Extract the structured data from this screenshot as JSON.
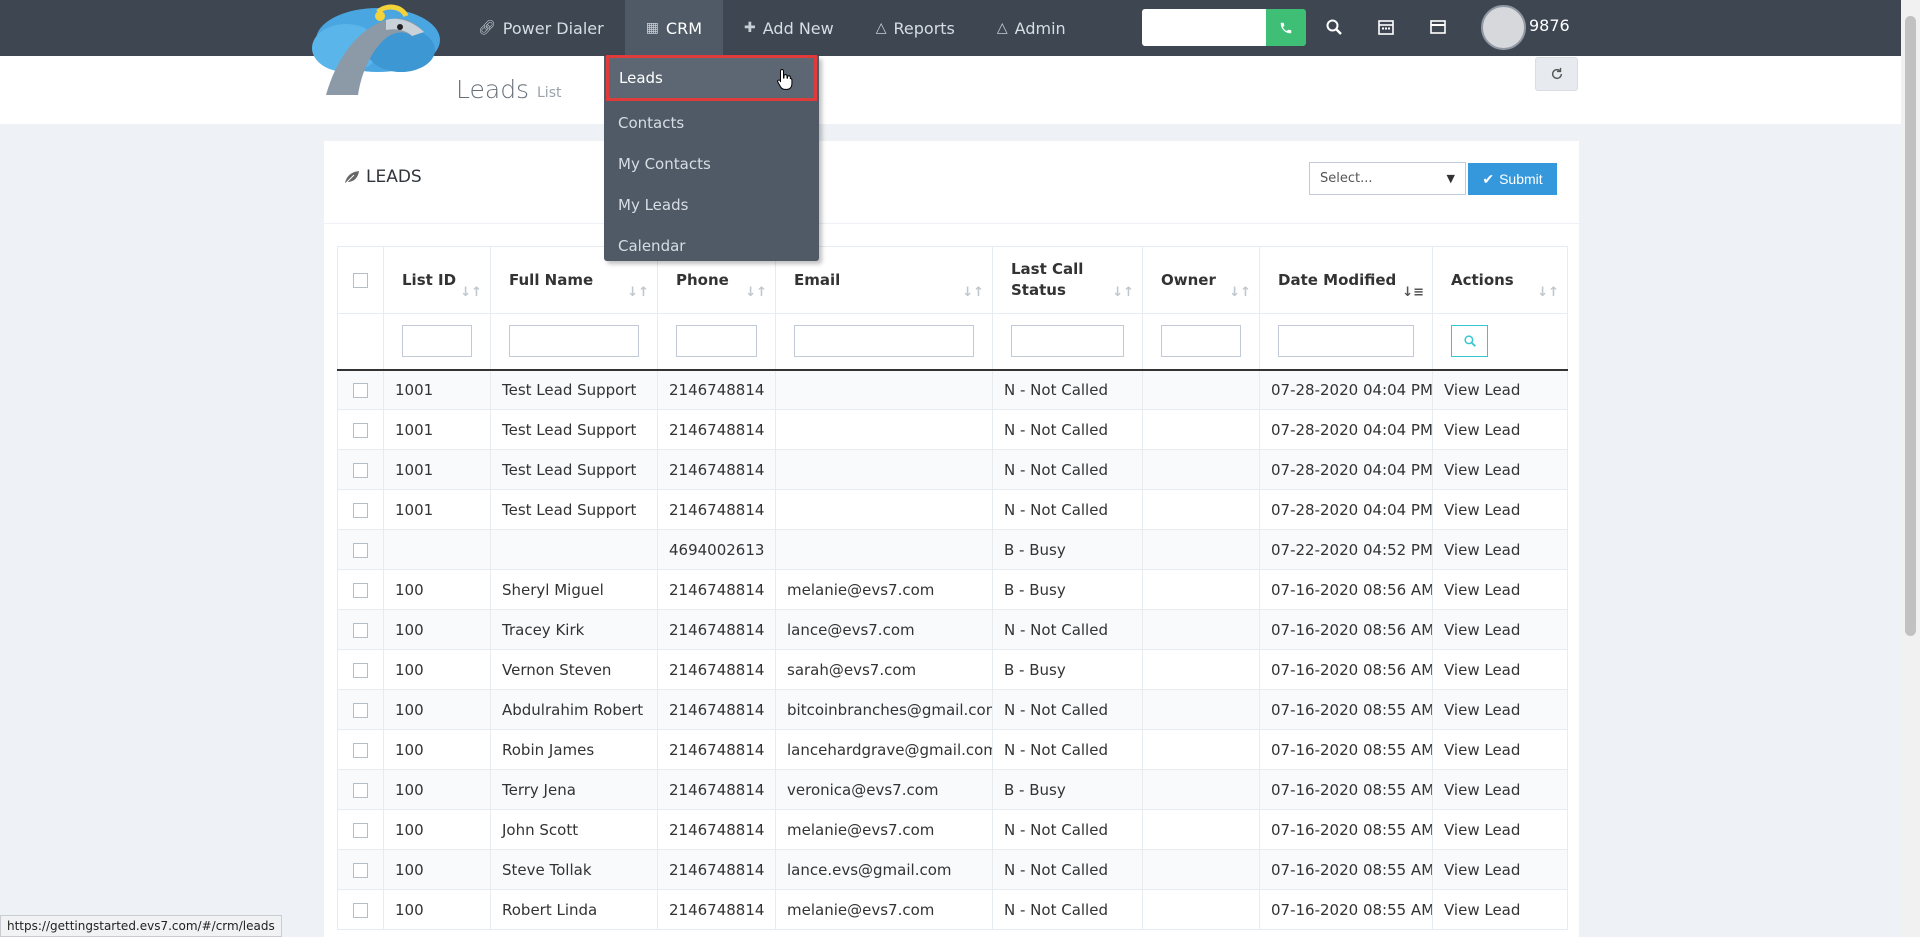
{
  "nav": {
    "items": [
      {
        "label": "Power Dialer",
        "icon": "link-icon"
      },
      {
        "label": "CRM",
        "icon": "book-icon"
      },
      {
        "label": "Add New",
        "icon": "plus-icon"
      },
      {
        "label": "Reports",
        "icon": "flask-icon"
      },
      {
        "label": "Admin",
        "icon": "flask-icon"
      }
    ],
    "user_id": "9876"
  },
  "page": {
    "title": "Leads",
    "subtitle": "List"
  },
  "crm_menu": {
    "items": [
      "Leads",
      "Contacts",
      "My Contacts",
      "My Leads",
      "Calendar"
    ]
  },
  "portlet": {
    "title": "LEADS",
    "select_placeholder": "Select...",
    "submit_label": "Submit"
  },
  "table": {
    "columns": [
      "List ID",
      "Full Name",
      "Phone",
      "Email",
      "Last Call Status",
      "Owner",
      "Date Modified",
      "Actions"
    ],
    "rows": [
      {
        "list_id": "1001",
        "name": "Test Lead Support",
        "phone": "2146748814",
        "email": "",
        "status": "N - Not Called",
        "owner": "",
        "date": "07-28-2020 04:04 PM",
        "action": "View Lead"
      },
      {
        "list_id": "1001",
        "name": "Test Lead Support",
        "phone": "2146748814",
        "email": "",
        "status": "N - Not Called",
        "owner": "",
        "date": "07-28-2020 04:04 PM",
        "action": "View Lead"
      },
      {
        "list_id": "1001",
        "name": "Test Lead Support",
        "phone": "2146748814",
        "email": "",
        "status": "N - Not Called",
        "owner": "",
        "date": "07-28-2020 04:04 PM",
        "action": "View Lead"
      },
      {
        "list_id": "1001",
        "name": "Test Lead Support",
        "phone": "2146748814",
        "email": "",
        "status": "N - Not Called",
        "owner": "",
        "date": "07-28-2020 04:04 PM",
        "action": "View Lead"
      },
      {
        "list_id": "",
        "name": "",
        "phone": "4694002613",
        "email": "",
        "status": "B - Busy",
        "owner": "",
        "date": "07-22-2020 04:52 PM",
        "action": "View Lead"
      },
      {
        "list_id": "100",
        "name": "Sheryl Miguel",
        "phone": "2146748814",
        "email": "melanie@evs7.com",
        "status": "B - Busy",
        "owner": "",
        "date": "07-16-2020 08:56 AM",
        "action": "View Lead"
      },
      {
        "list_id": "100",
        "name": "Tracey Kirk",
        "phone": "2146748814",
        "email": "lance@evs7.com",
        "status": "N - Not Called",
        "owner": "",
        "date": "07-16-2020 08:56 AM",
        "action": "View Lead"
      },
      {
        "list_id": "100",
        "name": "Vernon Steven",
        "phone": "2146748814",
        "email": "sarah@evs7.com",
        "status": "B - Busy",
        "owner": "",
        "date": "07-16-2020 08:56 AM",
        "action": "View Lead"
      },
      {
        "list_id": "100",
        "name": "Abdulrahim Robert",
        "phone": "2146748814",
        "email": "bitcoinbranches@gmail.com",
        "status": "N - Not Called",
        "owner": "",
        "date": "07-16-2020 08:55 AM",
        "action": "View Lead"
      },
      {
        "list_id": "100",
        "name": "Robin James",
        "phone": "2146748814",
        "email": "lancehardgrave@gmail.com",
        "status": "N - Not Called",
        "owner": "",
        "date": "07-16-2020 08:55 AM",
        "action": "View Lead"
      },
      {
        "list_id": "100",
        "name": "Terry Jena",
        "phone": "2146748814",
        "email": "veronica@evs7.com",
        "status": "B - Busy",
        "owner": "",
        "date": "07-16-2020 08:55 AM",
        "action": "View Lead"
      },
      {
        "list_id": "100",
        "name": "John Scott",
        "phone": "2146748814",
        "email": "melanie@evs7.com",
        "status": "N - Not Called",
        "owner": "",
        "date": "07-16-2020 08:55 AM",
        "action": "View Lead"
      },
      {
        "list_id": "100",
        "name": "Steve Tollak",
        "phone": "2146748814",
        "email": "lance.evs@gmail.com",
        "status": "N - Not Called",
        "owner": "",
        "date": "07-16-2020 08:55 AM",
        "action": "View Lead"
      },
      {
        "list_id": "100",
        "name": "Robert Linda",
        "phone": "2146748814",
        "email": "melanie@evs7.com",
        "status": "N - Not Called",
        "owner": "",
        "date": "07-16-2020 08:55 AM",
        "action": "View Lead"
      }
    ]
  },
  "statusbar": {
    "url": "https://gettingstarted.evs7.com/#/crm/leads"
  }
}
